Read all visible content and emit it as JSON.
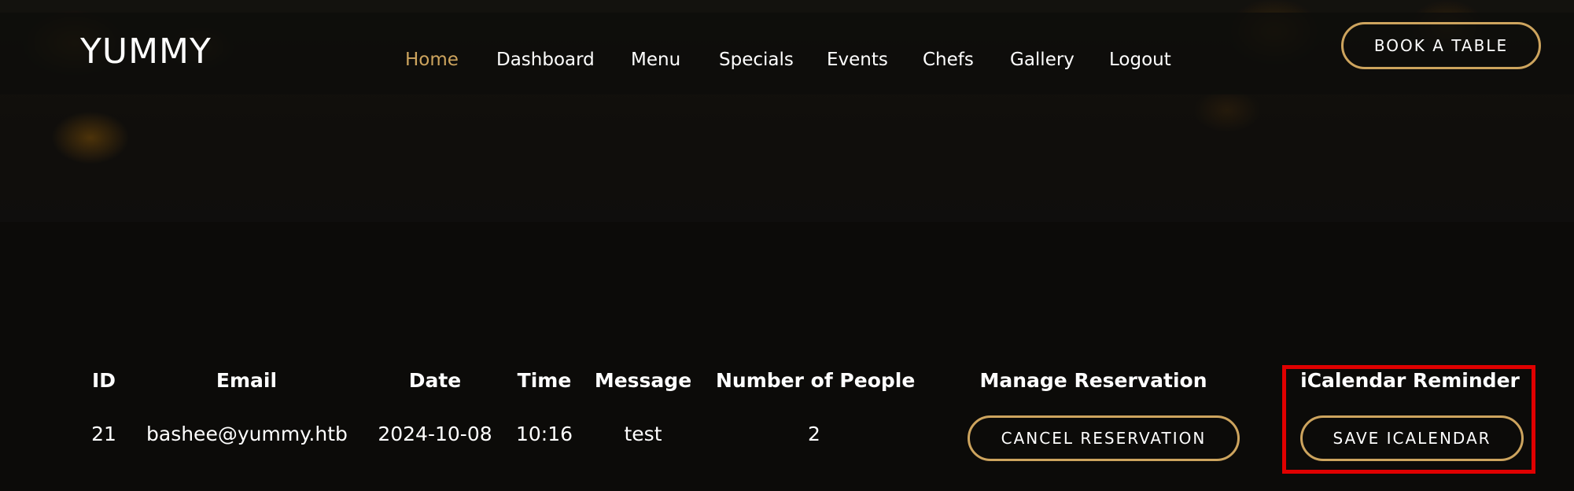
{
  "header": {
    "logo": "YUMMY",
    "nav": [
      {
        "label": "Home",
        "active": true
      },
      {
        "label": "Dashboard",
        "active": false
      },
      {
        "label": "Menu",
        "active": false
      },
      {
        "label": "Specials",
        "active": false
      },
      {
        "label": "Events",
        "active": false
      },
      {
        "label": "Chefs",
        "active": false
      },
      {
        "label": "Gallery",
        "active": false
      },
      {
        "label": "Logout",
        "active": false
      }
    ],
    "book_button": "BOOK A TABLE"
  },
  "table": {
    "headers": [
      "ID",
      "Email",
      "Date",
      "Time",
      "Message",
      "Number of People",
      "Manage Reservation",
      "iCalendar Reminder"
    ],
    "rows": [
      {
        "id": "21",
        "email": "bashee@yummy.htb",
        "date": "2024-10-08",
        "time": "10:16",
        "message": "test",
        "people": "2",
        "manage_button": "CANCEL RESERVATION",
        "ical_button": "SAVE ICALENDAR"
      }
    ]
  },
  "colors": {
    "accent": "#cda45e",
    "background": "#0c0b09",
    "highlight": "#e00000",
    "text": "#ffffff"
  }
}
